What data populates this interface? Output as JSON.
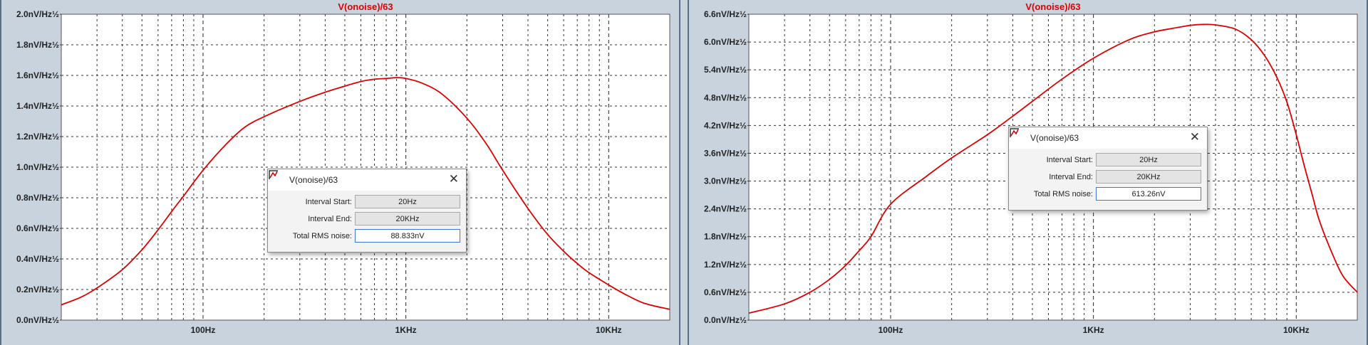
{
  "panels": [
    {
      "id": "left",
      "title": "V(onoise)/63",
      "dialog": {
        "title": "V(onoise)/63",
        "close_glyph": "✕",
        "interval_start_label": "Interval Start:",
        "interval_start_value": "20Hz",
        "interval_end_label": "Interval End:",
        "interval_end_value": "20KHz",
        "rms_label": "Total RMS noise:",
        "rms_value": "88.833nV"
      }
    },
    {
      "id": "right",
      "title": "V(onoise)/63",
      "dialog": {
        "title": "V(onoise)/63",
        "close_glyph": "✕",
        "interval_start_label": "Interval Start:",
        "interval_start_value": "20Hz",
        "interval_end_label": "Interval End:",
        "interval_end_value": "20KHz",
        "rms_label": "Total RMS noise:",
        "rms_value": "613.26nV"
      }
    }
  ],
  "chart_data": [
    {
      "type": "line",
      "title": "V(onoise)/63",
      "x_scale": "log",
      "xlim": [
        20,
        20000
      ],
      "ylim": [
        0,
        2.0
      ],
      "x_tick_labels": [
        {
          "x": 100,
          "label": "100Hz"
        },
        {
          "x": 1000,
          "label": "1KHz"
        },
        {
          "x": 10000,
          "label": "10KHz"
        }
      ],
      "y_tick_labels": [
        "0.0nV/Hz½",
        "0.2nV/Hz½",
        "0.4nV/Hz½",
        "0.6nV/Hz½",
        "0.8nV/Hz½",
        "1.0nV/Hz½",
        "1.2nV/Hz½",
        "1.4nV/Hz½",
        "1.6nV/Hz½",
        "1.8nV/Hz½",
        "2.0nV/Hz½"
      ],
      "y_ticks": [
        0,
        0.2,
        0.4,
        0.6,
        0.8,
        1.0,
        1.2,
        1.4,
        1.6,
        1.8,
        2.0
      ],
      "grid": true,
      "color": "#e00000",
      "series": [
        {
          "x": [
            20,
            25,
            30,
            40,
            50,
            60,
            70,
            80,
            100,
            130,
            160,
            200,
            300,
            400,
            500,
            600,
            700,
            800,
            900,
            1000,
            1200,
            1500,
            2000,
            2500,
            3000,
            4000,
            5000,
            6000,
            7000,
            8000,
            10000,
            12000,
            15000,
            20000
          ],
          "y": [
            0.1,
            0.15,
            0.21,
            0.33,
            0.46,
            0.59,
            0.71,
            0.81,
            0.98,
            1.15,
            1.26,
            1.33,
            1.43,
            1.49,
            1.53,
            1.56,
            1.575,
            1.58,
            1.585,
            1.58,
            1.55,
            1.48,
            1.32,
            1.15,
            0.98,
            0.73,
            0.56,
            0.45,
            0.37,
            0.31,
            0.23,
            0.17,
            0.11,
            0.07
          ]
        }
      ]
    },
    {
      "type": "line",
      "title": "V(onoise)/63",
      "x_scale": "log",
      "xlim": [
        20,
        20000
      ],
      "ylim": [
        0,
        6.6
      ],
      "x_tick_labels": [
        {
          "x": 100,
          "label": "100Hz"
        },
        {
          "x": 1000,
          "label": "1KHz"
        },
        {
          "x": 10000,
          "label": "10KHz"
        }
      ],
      "y_tick_labels": [
        "0.0nV/Hz½",
        "0.6nV/Hz½",
        "1.2nV/Hz½",
        "1.8nV/Hz½",
        "2.4nV/Hz½",
        "3.0nV/Hz½",
        "3.6nV/Hz½",
        "4.2nV/Hz½",
        "4.8nV/Hz½",
        "5.4nV/Hz½",
        "6.0nV/Hz½",
        "6.6nV/Hz½"
      ],
      "y_ticks": [
        0,
        0.6,
        1.2,
        1.8,
        2.4,
        3.0,
        3.6,
        4.2,
        4.8,
        5.4,
        6.0,
        6.6
      ],
      "grid": true,
      "color": "#e00000",
      "series": [
        {
          "x": [
            20,
            30,
            40,
            50,
            60,
            70,
            80,
            100,
            150,
            200,
            300,
            400,
            500,
            700,
            1000,
            1500,
            2000,
            2500,
            3000,
            3500,
            4000,
            5000,
            6000,
            7000,
            8000,
            9000,
            10000,
            11000,
            12000,
            13000,
            15000,
            17000,
            20000
          ],
          "y": [
            0.15,
            0.35,
            0.6,
            0.88,
            1.18,
            1.5,
            1.8,
            2.5,
            3.1,
            3.5,
            4.0,
            4.4,
            4.72,
            5.2,
            5.65,
            6.05,
            6.22,
            6.3,
            6.36,
            6.38,
            6.37,
            6.28,
            6.05,
            5.7,
            5.25,
            4.7,
            4.0,
            3.3,
            2.7,
            2.15,
            1.45,
            0.95,
            0.6
          ]
        }
      ]
    }
  ]
}
